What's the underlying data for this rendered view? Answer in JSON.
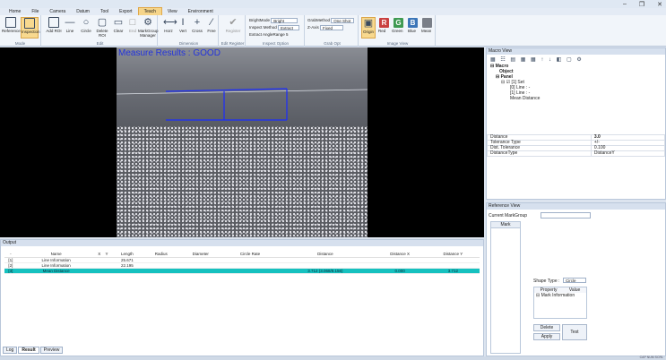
{
  "menu": [
    "Home",
    "File",
    "Camera",
    "Datum",
    "Tool",
    "Export",
    "Teach",
    "View",
    "Environment"
  ],
  "active_menu": "Teach",
  "window_buttons": [
    "–",
    "❐",
    "✕"
  ],
  "ribbon": {
    "mode": {
      "label": "Mode",
      "buttons": [
        "Reference",
        "Inspection"
      ]
    },
    "edit": {
      "label": "Edit",
      "buttons": [
        "Add ROI",
        "Line",
        "Circle",
        "Delete ROI",
        "Clear",
        "End",
        "MarkGroup Manager"
      ]
    },
    "dimension": {
      "label": "Dimension",
      "buttons": [
        "Horz",
        "Vert",
        "Cross",
        "Free"
      ]
    },
    "edit_register": {
      "label": "Edit Register",
      "buttons": [
        "Register"
      ]
    },
    "inspect_option": {
      "label": "Inspect Option",
      "bright_mode_label": "BrightMode",
      "bright_mode": "Bright",
      "inspect_method_label": "Inspect Method",
      "inspect_method": "Extract",
      "extract_angle_label": "Extract AngleRange",
      "extract_angle": "5"
    },
    "grab_opt": {
      "label": "Grab Opt",
      "grab_method_label": "GrabMethod",
      "grab_method": "One Shot",
      "zaxis_label": "Z-Axis",
      "zaxis": "Fixed"
    },
    "image_view": {
      "label": "Image View",
      "buttons": [
        "Origin",
        "Red",
        "Green",
        "Blue",
        "Mean"
      ],
      "letters": [
        "R",
        "G",
        "B"
      ]
    }
  },
  "image": {
    "measure_text": "Measure Results : GOOD"
  },
  "output": {
    "title": "Output",
    "columns": [
      "-",
      "Name",
      "X",
      "Y",
      "Length",
      "Radius",
      "Diameter",
      "Circle Rate",
      "Distance",
      "Distance X",
      "Distance Y"
    ],
    "rows": [
      {
        "idx": "[1]",
        "name": "Line Information",
        "x": "",
        "y": "",
        "length": "25.671",
        "radius": "",
        "diameter": "",
        "circle": "",
        "distance": "",
        "dx": "",
        "dy": ""
      },
      {
        "idx": "[2]",
        "name": "Line Information",
        "x": "",
        "y": "",
        "length": "22.195",
        "radius": "",
        "diameter": "",
        "circle": "",
        "distance": "",
        "dx": "",
        "dy": ""
      },
      {
        "idx": "[3]",
        "name": "Mean Distance",
        "x": "",
        "y": "",
        "length": "",
        "radius": "",
        "diameter": "",
        "circle": "",
        "distance": "3.712 (3.068/8.156)",
        "dx": "0.000",
        "dy": "3.712"
      }
    ],
    "tabs": [
      "Log",
      "Result",
      "Preview"
    ]
  },
  "macro": {
    "title": "Macro View",
    "tree": [
      "Macro",
      "Object",
      "Panel",
      "[1] Set",
      "[0] Line : -",
      "[1] Line : -",
      "Mean Distance"
    ],
    "props": [
      [
        "Distance",
        "3.0"
      ],
      [
        "Tolerance Type",
        "+/-"
      ],
      [
        "Dist. Tolerance",
        "0.100"
      ],
      [
        "DistanceType",
        "DistanceY"
      ]
    ]
  },
  "reference": {
    "title": "Reference View",
    "current_markgroup_label": "Current MarkGroup",
    "mark_label": "Mark",
    "shape_type_label": "Shape Type :",
    "shape_type": "Circle",
    "prop_header": [
      "Property",
      "Value"
    ],
    "mark_info": "Mark Information",
    "delete": "Delete",
    "apply": "Apply",
    "test": "Test"
  },
  "status": "CAP  NUM  SCRL"
}
